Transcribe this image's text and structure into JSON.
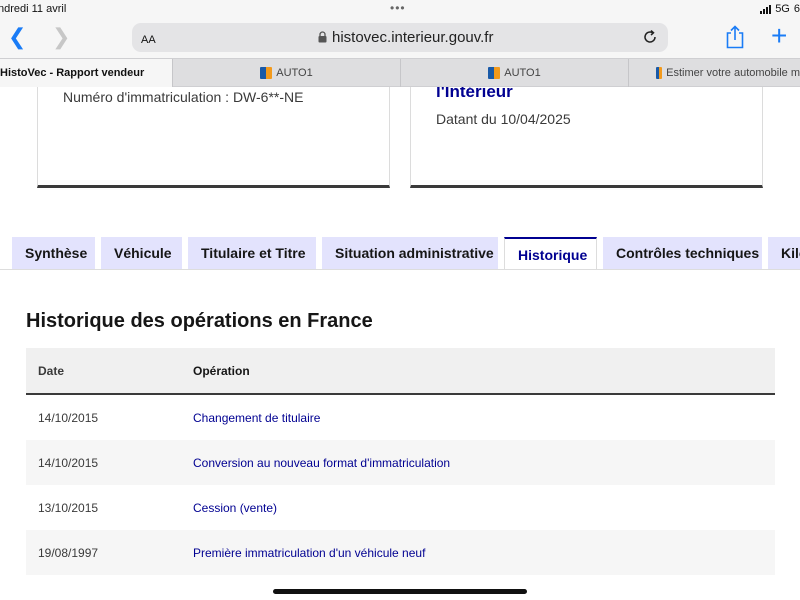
{
  "status_bar": {
    "time": "ndredi 11 avril",
    "dots": "•••",
    "network": "5G",
    "battery": "6"
  },
  "browser": {
    "text_size_label": "AA",
    "url": "histovec.interieur.gouv.fr",
    "tabs": [
      {
        "label": "HistoVec - Rapport vendeur",
        "active": true
      },
      {
        "label": "AUTO1",
        "active": false
      },
      {
        "label": "AUTO1",
        "active": false
      },
      {
        "label": "Estimer votre automobile m",
        "active": false
      }
    ]
  },
  "cards": {
    "left_text": "Numéro d'immatriculation : DW-6**-NE",
    "right_title": "l'Intérieur",
    "right_text": "Datant du 10/04/2025"
  },
  "content_tabs": [
    {
      "label": "Synthèse",
      "active": false
    },
    {
      "label": "Véhicule",
      "active": false
    },
    {
      "label": "Titulaire et Titre",
      "active": false
    },
    {
      "label": "Situation administrative",
      "active": false
    },
    {
      "label": "Historique",
      "active": true
    },
    {
      "label": "Contrôles techniques",
      "active": false
    },
    {
      "label": "Kilo",
      "active": false
    }
  ],
  "history": {
    "title": "Historique des opérations en France",
    "columns": {
      "date": "Date",
      "operation": "Opération"
    },
    "rows": [
      {
        "date": "14/10/2015",
        "operation": "Changement de titulaire"
      },
      {
        "date": "14/10/2015",
        "operation": "Conversion au nouveau format d'immatriculation"
      },
      {
        "date": "13/10/2015",
        "operation": "Cession (vente)"
      },
      {
        "date": "19/08/1997",
        "operation": "Première immatriculation d'un véhicule neuf"
      }
    ]
  },
  "colors": {
    "accent": "#000091",
    "tab_background": "#e3e3fd",
    "ios_blue": "#1a7cf6"
  }
}
